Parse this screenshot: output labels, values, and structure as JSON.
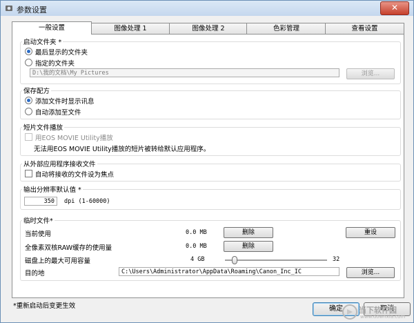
{
  "window": {
    "title": "参数设置",
    "close_glyph": "✕"
  },
  "tabs": [
    {
      "label": "一般设置",
      "active": true
    },
    {
      "label": "图像处理 1"
    },
    {
      "label": "图像处理 2"
    },
    {
      "label": "色彩管理"
    },
    {
      "label": "查看设置"
    }
  ],
  "startup_folder": {
    "title": "启动文件夹 *",
    "option_last": "最后显示的文件夹",
    "option_specified": "指定的文件夹",
    "path": "D:\\我的文档\\My Pictures",
    "browse": "浏览..."
  },
  "save_recipe": {
    "title": "保存配方",
    "option_message": "添加文件时显示讯息",
    "option_auto": "自动添加至文件"
  },
  "movie_playback": {
    "title": "短片文件播放",
    "checkbox": "用EOS MOVIE Utility播放",
    "note": "无法用EOS MOVIE Utility播放的短片被转给默认应用程序。"
  },
  "external_receive": {
    "title": "从外部应用程序接收文件",
    "checkbox": "自动将接收的文件设为焦点"
  },
  "resolution": {
    "title": "输出分辨率默认值 *",
    "value": "350",
    "unit": "dpi (1-60000)"
  },
  "temp_files": {
    "title": "临时文件*",
    "current_usage_label": "当前使用",
    "current_usage_value": "0.0 MB",
    "delete_label": "删除",
    "reset_label": "重设",
    "cache_label": "全像素双核RAW缓存的使用量",
    "cache_value": "0.0 MB",
    "disk_label": "磁盘上的最大可用容量",
    "slider_min": "4 GB",
    "slider_max": "32",
    "slider_level": 0.07,
    "dest_label": "目的地",
    "dest_path": "C:\\Users\\Administrator\\AppData\\Roaming\\Canon_Inc_IC",
    "browse": "浏览..."
  },
  "footer": {
    "note": "*重新启动后变更生效",
    "ok": "确定",
    "cancel": "取消"
  },
  "watermark": {
    "text": "当下软件园",
    "sub": "www.downxia.com"
  },
  "colors": {
    "accent": "#2a6bc5",
    "titlebar": "#c4d7ee",
    "close": "#c6402c"
  }
}
